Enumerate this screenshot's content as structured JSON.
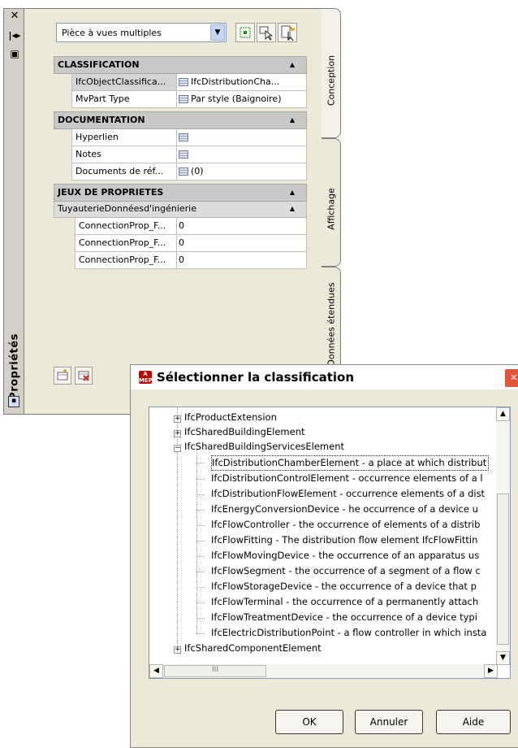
{
  "palette": {
    "title": "Propriétés",
    "style_select": "Pièce à vues multiples",
    "tabs": [
      "Conception",
      "Affichage",
      "Données étendues"
    ],
    "categories": {
      "classification": {
        "title": "CLASSIFICATION",
        "rows": [
          {
            "name": "IfcObjectClassifica...",
            "value": "IfcDistributionCha..."
          },
          {
            "name": "MvPart Type",
            "value": "Par style (Baignoire)"
          }
        ]
      },
      "documentation": {
        "title": "DOCUMENTATION",
        "rows": [
          {
            "name": "Hyperlien",
            "value": ""
          },
          {
            "name": "Notes",
            "value": ""
          },
          {
            "name": "Documents de réf...",
            "value": "(0)"
          }
        ]
      },
      "property_sets": {
        "title": "JEUX DE PROPRIETES",
        "subcategory": "TuyauterieDonnéesd'ingénierie",
        "rows": [
          {
            "name": "ConnectionProp_F...",
            "value": "0"
          },
          {
            "name": "ConnectionProp_F...",
            "value": "0"
          },
          {
            "name": "ConnectionProp_F...",
            "value": "0"
          }
        ]
      }
    }
  },
  "dialog": {
    "title": "Sélectionner la classification",
    "tree": [
      {
        "label": "IfcProductExtension",
        "expanded": false
      },
      {
        "label": "IfcSharedBuildingElement",
        "expanded": false
      },
      {
        "label": "IfcSharedBuildingServicesElement",
        "expanded": true
      }
    ],
    "children": [
      "IfcDistributionChamberElement - a place at which distribut",
      "IfcDistributionControlElement - occurrence elements of a l",
      "IfcDistributionFlowElement - occurrence elements of a dist",
      "IfcEnergyConversionDevice - he occurrence of a device u",
      "IfcFlowController - the occurrence of elements of a distrib",
      "IfcFlowFitting - The distribution flow element IfcFlowFittin",
      "IfcFlowMovingDevice - the occurrence of an apparatus us",
      "IfcFlowSegment - the occurrence of a segment of a flow c",
      "IfcFlowStorageDevice - the occurrence of a device that p",
      "IfcFlowTerminal - the occurrence of a permanently attach",
      "IfcFlowTreatmentDevice - the occurrence of a device typi",
      "IfcElectricDistributionPoint - a flow controller in which insta"
    ],
    "last_node": "IfcSharedComponentElement",
    "hscroll_grip": "III",
    "buttons": {
      "ok": "OK",
      "cancel": "Annuler",
      "help": "Aide"
    }
  }
}
